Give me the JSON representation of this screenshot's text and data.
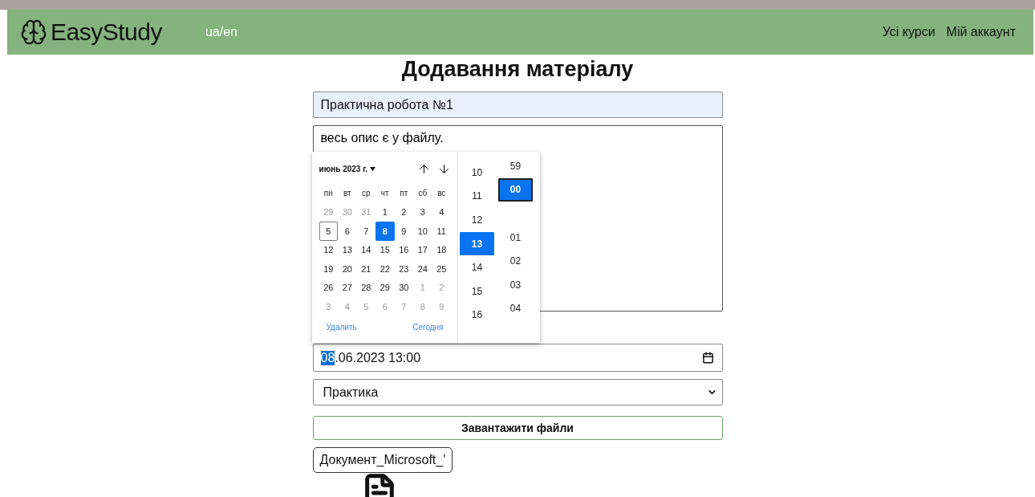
{
  "navbar": {
    "logo": "EasyStudy",
    "language": {
      "label": "ua/en",
      "highlighted": true
    },
    "links": [
      "Усі курси",
      "Мій аккаунт"
    ]
  },
  "page_title": "Додавання матеріалу",
  "form": {
    "title_field": {
      "value": "Практична робота №1",
      "autofilled": true
    },
    "description_field": {
      "value": "весь опис є у файлу."
    },
    "date_field": {
      "parts": [
        {
          "text": "08",
          "selected": true
        },
        {
          "text": ".06.2023 13:00",
          "selected": false
        }
      ]
    },
    "type_select": {
      "value": "Практика"
    },
    "upload_button": "Завантажити файли",
    "files": [
      {
        "name": "Документ_Microsoft_'"
      }
    ]
  },
  "date_picker": {
    "month": "июнь 2023 г.",
    "weekdays": [
      "пн",
      "вт",
      "ср",
      "чт",
      "пт",
      "сб",
      "вс"
    ],
    "weeks": [
      [
        {
          "day": "29",
          "outside": true,
          "selected": false,
          "today": false
        },
        {
          "day": "30",
          "outside": true,
          "selected": false,
          "today": false
        },
        {
          "day": "31",
          "outside": true,
          "selected": false,
          "today": false
        },
        {
          "day": "1",
          "outside": false,
          "selected": false,
          "today": false
        },
        {
          "day": "2",
          "outside": false,
          "selected": false,
          "today": false
        },
        {
          "day": "3",
          "outside": false,
          "selected": false,
          "today": false
        },
        {
          "day": "4",
          "outside": false,
          "selected": false,
          "today": false
        }
      ],
      [
        {
          "day": "5",
          "outside": false,
          "selected": false,
          "today": true
        },
        {
          "day": "6",
          "outside": false,
          "selected": false,
          "today": false
        },
        {
          "day": "7",
          "outside": false,
          "selected": false,
          "today": false
        },
        {
          "day": "8",
          "outside": false,
          "selected": true,
          "today": false
        },
        {
          "day": "9",
          "outside": false,
          "selected": false,
          "today": false
        },
        {
          "day": "10",
          "outside": false,
          "selected": false,
          "today": false
        },
        {
          "day": "11",
          "outside": false,
          "selected": false,
          "today": false
        }
      ],
      [
        {
          "day": "12",
          "outside": false,
          "selected": false,
          "today": false
        },
        {
          "day": "13",
          "outside": false,
          "selected": false,
          "today": false
        },
        {
          "day": "14",
          "outside": false,
          "selected": false,
          "today": false
        },
        {
          "day": "15",
          "outside": false,
          "selected": false,
          "today": false
        },
        {
          "day": "16",
          "outside": false,
          "selected": false,
          "today": false
        },
        {
          "day": "17",
          "outside": false,
          "selected": false,
          "today": false
        },
        {
          "day": "18",
          "outside": false,
          "selected": false,
          "today": false
        }
      ],
      [
        {
          "day": "19",
          "outside": false,
          "selected": false,
          "today": false
        },
        {
          "day": "20",
          "outside": false,
          "selected": false,
          "today": false
        },
        {
          "day": "21",
          "outside": false,
          "selected": false,
          "today": false
        },
        {
          "day": "22",
          "outside": false,
          "selected": false,
          "today": false
        },
        {
          "day": "23",
          "outside": false,
          "selected": false,
          "today": false
        },
        {
          "day": "24",
          "outside": false,
          "selected": false,
          "today": false
        },
        {
          "day": "25",
          "outside": false,
          "selected": false,
          "today": false
        }
      ],
      [
        {
          "day": "26",
          "outside": false,
          "selected": false,
          "today": false
        },
        {
          "day": "27",
          "outside": false,
          "selected": false,
          "today": false
        },
        {
          "day": "28",
          "outside": false,
          "selected": false,
          "today": false
        },
        {
          "day": "29",
          "outside": false,
          "selected": false,
          "today": false
        },
        {
          "day": "30",
          "outside": false,
          "selected": false,
          "today": false
        },
        {
          "day": "1",
          "outside": true,
          "selected": false,
          "today": false
        },
        {
          "day": "2",
          "outside": true,
          "selected": false,
          "today": false
        }
      ],
      [
        {
          "day": "3",
          "outside": true,
          "selected": false,
          "today": false
        },
        {
          "day": "4",
          "outside": true,
          "selected": false,
          "today": false
        },
        {
          "day": "5",
          "outside": true,
          "selected": false,
          "today": false
        },
        {
          "day": "6",
          "outside": true,
          "selected": false,
          "today": false
        },
        {
          "day": "7",
          "outside": true,
          "selected": false,
          "today": false
        },
        {
          "day": "8",
          "outside": true,
          "selected": false,
          "today": false
        },
        {
          "day": "9",
          "outside": true,
          "selected": false,
          "today": false
        }
      ]
    ],
    "clear": "Удалить",
    "today": "Сегодня",
    "hours": [
      {
        "label": "10",
        "selected": false
      },
      {
        "label": "11",
        "selected": false
      },
      {
        "label": "12",
        "selected": false
      },
      {
        "label": "13",
        "selected": true
      },
      {
        "label": "14",
        "selected": false
      },
      {
        "label": "15",
        "selected": false
      },
      {
        "label": "16",
        "selected": false
      }
    ],
    "minutes": [
      {
        "label": "59",
        "selected": false
      },
      {
        "label": "00",
        "selected": true
      },
      {
        "label": "01",
        "selected": false
      },
      {
        "label": "02",
        "selected": false
      },
      {
        "label": "03",
        "selected": false
      },
      {
        "label": "04",
        "selected": false
      }
    ]
  }
}
